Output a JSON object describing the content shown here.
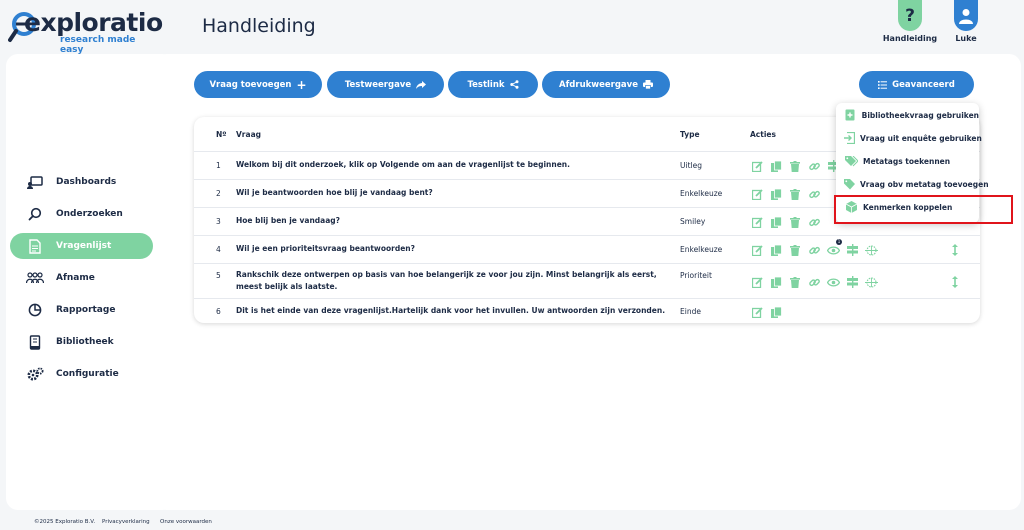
{
  "brand": {
    "name": "exploratio",
    "tagline": "research made easy",
    "accent": "#2f80d1",
    "green": "#7fd3a1",
    "navy": "#1d2b45"
  },
  "page_title": "Handleiding",
  "top_actions": [
    {
      "label": "Handleiding",
      "icon": "question-icon"
    },
    {
      "label": "Luke",
      "icon": "user-icon"
    }
  ],
  "sidebar": {
    "items": [
      {
        "label": "Dashboards",
        "icon": "dashboard-icon"
      },
      {
        "label": "Onderzoeken",
        "icon": "search-icon"
      },
      {
        "label": "Vragenlijst",
        "icon": "document-icon",
        "active": true
      },
      {
        "label": "Afname",
        "icon": "people-icon"
      },
      {
        "label": "Rapportage",
        "icon": "pie-chart-icon"
      },
      {
        "label": "Bibliotheek",
        "icon": "book-icon"
      },
      {
        "label": "Configuratie",
        "icon": "gears-icon"
      }
    ]
  },
  "toolbar": {
    "add_question": "Vraag toevoegen",
    "test_view": "Testweergave",
    "test_link": "Testlink",
    "print_view": "Afdrukweergave",
    "advanced": "Geavanceerd"
  },
  "table": {
    "headers": {
      "nr": "Nº",
      "question": "Vraag",
      "type": "Type",
      "actions": "Acties"
    },
    "rows": [
      {
        "nr": "1",
        "question": "Welkom bij dit onderzoek, klik op Volgende om aan de vragenlijst te beginnen.",
        "type": "Uitleg"
      },
      {
        "nr": "2",
        "question": "Wil je beantwoorden hoe blij je vandaag bent?",
        "type": "Enkelkeuze"
      },
      {
        "nr": "3",
        "question": "Hoe blij ben je vandaag?",
        "type": "Smiley"
      },
      {
        "nr": "4",
        "question": "Wil je een prioriteitsvraag beantwoorden?",
        "type": "Enkelkeuze"
      },
      {
        "nr": "5",
        "question": "Rankschik deze ontwerpen op basis van hoe belangerijk ze voor jou zijn. Minst belangrijk als eerst, meest belijk als laatste.",
        "type": "Prioriteit"
      },
      {
        "nr": "6",
        "question": "Dit is het einde van deze vragenlijst.Hartelijk dank voor het invullen. Uw antwoorden zijn verzonden.",
        "type": "Einde"
      }
    ],
    "condition_badge": "1"
  },
  "advanced_menu": {
    "items": [
      {
        "label": "Bibliotheekvraag gebruiken",
        "icon": "library-add-icon"
      },
      {
        "label": "Vraag uit enquête gebruiken",
        "icon": "import-icon"
      },
      {
        "label": "Metatags toekennen",
        "icon": "tags-icon"
      },
      {
        "label": "Vraag obv metatag toevoegen",
        "icon": "tag-icon"
      },
      {
        "label": "Kenmerken koppelen",
        "icon": "cube-icon"
      }
    ]
  },
  "footer": {
    "copyright": "©2025 Exploratio B.V.",
    "privacy": "Privacyverklaring",
    "terms": "Onze voorwaarden"
  }
}
